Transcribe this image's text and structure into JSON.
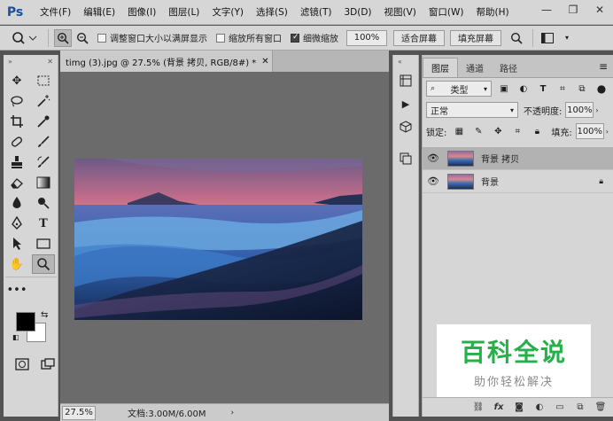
{
  "app": {
    "logo": "Ps"
  },
  "menu": [
    "文件(F)",
    "编辑(E)",
    "图像(I)",
    "图层(L)",
    "文字(Y)",
    "选择(S)",
    "滤镜(T)",
    "3D(D)",
    "视图(V)",
    "窗口(W)",
    "帮助(H)"
  ],
  "options": {
    "resize_windows": "调整窗口大小以满屏显示",
    "zoom_all": "缩放所有窗口",
    "scrubby_zoom": "细微缩放",
    "zoom_value": "100%",
    "fit_screen": "适合屏幕",
    "fill_screen": "填充屏幕"
  },
  "document": {
    "tab_title": "timg (3).jpg @ 27.5% (背景 拷贝, RGB/8#) *",
    "zoom": "27.5%",
    "doc_info": "文档:3.00M/6.00M"
  },
  "layers_panel": {
    "tabs": [
      "图层",
      "通道",
      "路径"
    ],
    "filter_kind": "类型",
    "blend_mode": "正常",
    "opacity_label": "不透明度:",
    "opacity_value": "100%",
    "lock_label": "锁定:",
    "fill_label": "填充:",
    "fill_value": "100%",
    "layers": [
      {
        "name": "背景 拷贝",
        "selected": true
      },
      {
        "name": "背景",
        "locked": true
      }
    ]
  },
  "watermark": {
    "title": "百科全说",
    "subtitle": "助你轻松解决"
  }
}
